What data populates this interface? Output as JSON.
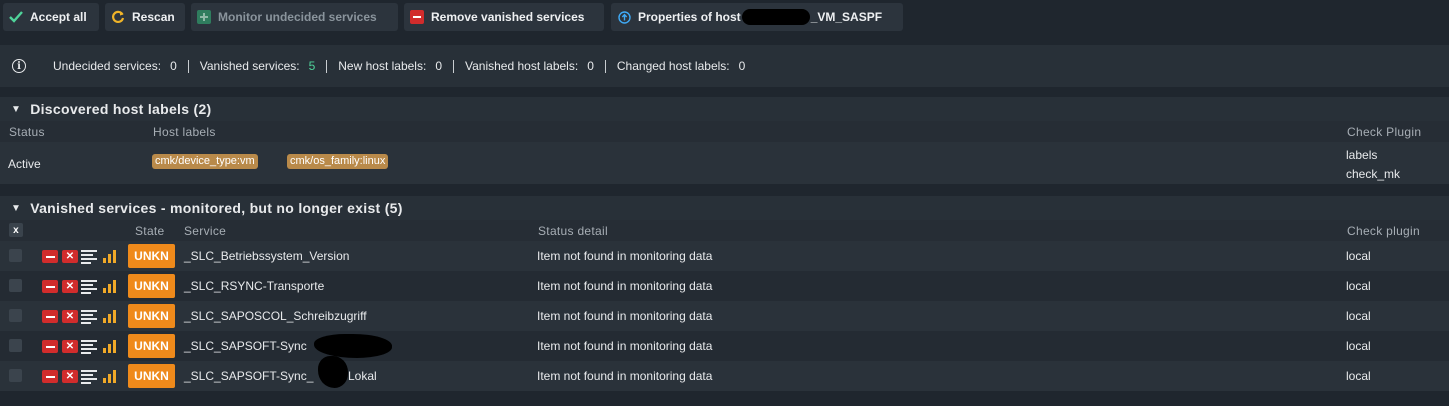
{
  "toolbar": {
    "accept_all": "Accept all",
    "rescan": "Rescan",
    "monitor_undecided": "Monitor undecided services",
    "remove_vanished": "Remove vanished services",
    "properties_prefix": "Properties of host",
    "properties_suffix": "_VM_SASPF"
  },
  "summary": {
    "undecided_label": "Undecided services:",
    "undecided_value": "0",
    "vanished_label": "Vanished services:",
    "vanished_value": "5",
    "new_labels_label": "New host labels:",
    "new_labels_value": "0",
    "vanished_labels_label": "Vanished host labels:",
    "vanished_labels_value": "0",
    "changed_labels_label": "Changed host labels:",
    "changed_labels_value": "0"
  },
  "host_labels": {
    "title": "Discovered host labels (2)",
    "columns": {
      "status": "Status",
      "host_labels": "Host labels",
      "check_plugin": "Check Plugin"
    },
    "row": {
      "status": "Active",
      "labels": [
        "cmk/device_type:vm",
        "cmk/os_family:linux"
      ],
      "plugins": [
        "labels",
        "check_mk"
      ]
    }
  },
  "vanished": {
    "title": "Vanished services - monitored, but no longer exist (5)",
    "columns": {
      "select_all": "x",
      "state": "State",
      "service": "Service",
      "status_detail": "Status detail",
      "check_plugin": "Check plugin"
    },
    "rows": [
      {
        "state": "UNKN",
        "service": "_SLC_Betriebssystem_Version",
        "detail": "Item not found in monitoring data",
        "plugin": "local"
      },
      {
        "state": "UNKN",
        "service": "_SLC_RSYNC-Transporte",
        "detail": "Item not found in monitoring data",
        "plugin": "local"
      },
      {
        "state": "UNKN",
        "service": "_SLC_SAPOSCOL_Schreibzugriff",
        "detail": "Item not found in monitoring data",
        "plugin": "local"
      },
      {
        "state": "UNKN",
        "service": "_SLC_SAPSOFT-Sync",
        "detail": "Item not found in monitoring data",
        "plugin": "local"
      },
      {
        "state": "UNKN",
        "service": "_SLC_SAPSOFT-Sync_",
        "service_tail": "Lokal",
        "detail": "Item not found in monitoring data",
        "plugin": "local"
      }
    ]
  },
  "colors": {
    "unknown_state": "#ef8a1b",
    "remove_red": "#d12c2c",
    "label_chip": "#b98a4a",
    "vanished_count": "#4fd39a"
  }
}
